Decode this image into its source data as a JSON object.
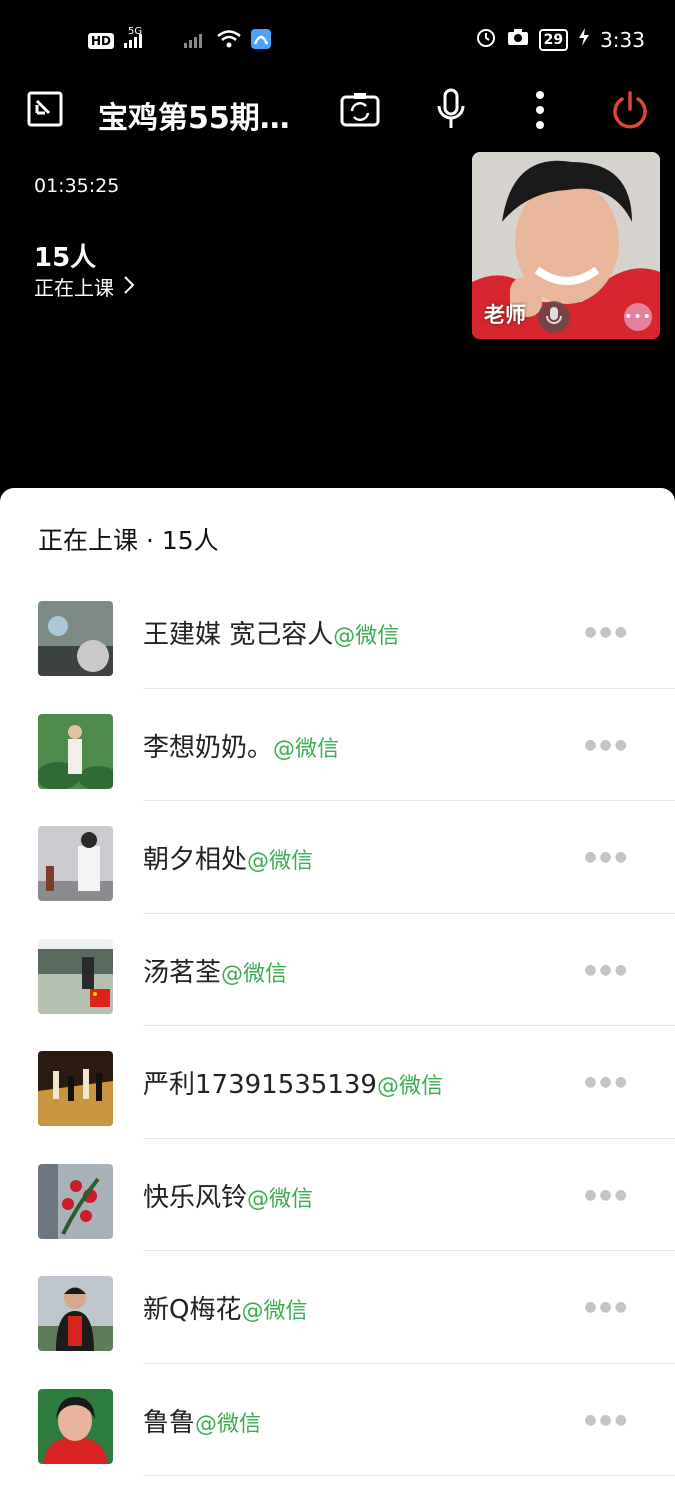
{
  "status_bar": {
    "net": "HD",
    "signal_label": "5G",
    "time": "3:33",
    "battery": "29"
  },
  "header": {
    "title": "宝鸡第55期…"
  },
  "call": {
    "timer": "01:35:25",
    "count": "15人",
    "in_class": "正在上课"
  },
  "teacher": {
    "label": "老师"
  },
  "sheet": {
    "title": "正在上课 · 15人"
  },
  "participants": [
    {
      "name": "王建媒 宽己容人",
      "tag": "@微信"
    },
    {
      "name": "李想奶奶。",
      "tag": "@微信"
    },
    {
      "name": "朝夕相处",
      "tag": "@微信"
    },
    {
      "name": "汤茗荃",
      "tag": "@微信"
    },
    {
      "name": "严利17391535139",
      "tag": "@微信"
    },
    {
      "name": "快乐风铃",
      "tag": "@微信"
    },
    {
      "name": "新Q梅花",
      "tag": "@微信"
    },
    {
      "name": "鲁鲁",
      "tag": "@微信"
    }
  ],
  "colors": {
    "accent_green": "#3bad52",
    "hangup_red": "#e0443a"
  },
  "icons": [
    "minimize-icon",
    "camera-flip-icon",
    "microphone-icon",
    "more-vertical-icon",
    "power-icon",
    "chevron-right-icon",
    "more-horizontal-icon"
  ]
}
